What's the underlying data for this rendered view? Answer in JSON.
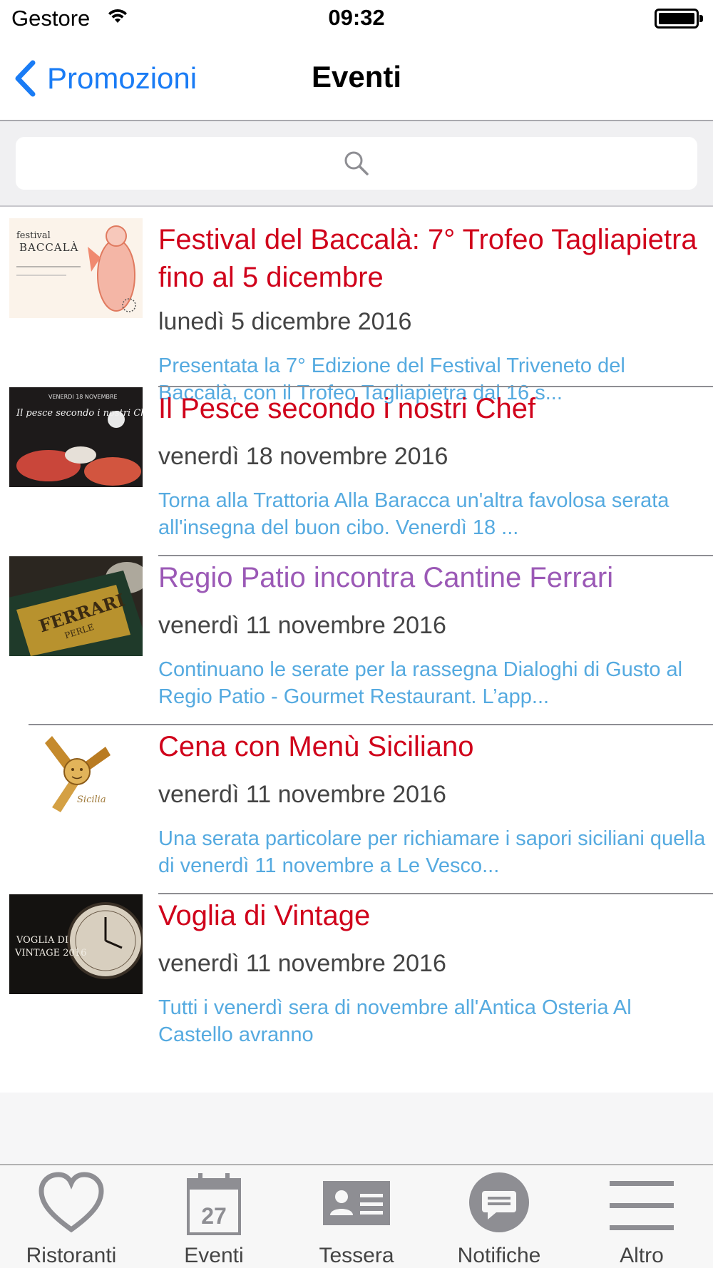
{
  "status_bar": {
    "carrier": "Gestore",
    "time": "09:32"
  },
  "nav": {
    "back_label": "Promozioni",
    "title": "Eventi"
  },
  "search": {
    "placeholder": ""
  },
  "events": [
    {
      "title": "Festival del Baccalà: 7° Trofeo Tagliapietra fino al 5 dicembre",
      "date": "lunedì 5 dicembre 2016",
      "description": "Presentata la 7° Edizione del Festival Triveneto del Baccalà, con il Trofeo Tagliapietra dal 16 s...",
      "thumb_text": {
        "line1": "festival",
        "line2": "BACCALÀ"
      }
    },
    {
      "title": "Il Pesce secondo i nostri Chef",
      "date": "venerdì 18 novembre 2016",
      "description": "Torna alla Trattoria Alla Baracca un'altra favolosa serata all'insegna del buon cibo. Venerdì 18 ...",
      "thumb_text": {
        "line1": "VENERDI 18 NOVEMBRE",
        "line2": "Il pesce secondo i nostri Chef"
      }
    },
    {
      "title": "Regio Patio incontra Cantine Ferrari",
      "date": "venerdì 11 novembre 2016",
      "description": "Continuano le serate per la rassegna Dialoghi di Gusto al Regio Patio - Gourmet Restaurant. L’app...",
      "thumb_text": {
        "line1": "FERRARI",
        "line2": "PERLE"
      }
    },
    {
      "title": "Cena con Menù Siciliano",
      "date": "venerdì 11 novembre 2016",
      "description": "Una serata particolare per richiamare i sapori siciliani quella di venerdì 11 novembre a Le Vesco...",
      "thumb_text": {
        "line1": "Sicilia",
        "line2": ""
      }
    },
    {
      "title": "Voglia di Vintage",
      "date": "venerdì 11 novembre 2016",
      "description": "Tutti i venerdì sera di novembre all'Antica Osteria Al Castello avranno",
      "thumb_text": {
        "line1": "VOGLIA DI",
        "line2": "VINTAGE 2016"
      }
    }
  ],
  "tabs": [
    {
      "label": "Ristoranti",
      "icon": "heart-icon"
    },
    {
      "label": "Eventi",
      "icon": "calendar-icon",
      "badge": "27"
    },
    {
      "label": "Tessera",
      "icon": "card-icon"
    },
    {
      "label": "Notifiche",
      "icon": "message-icon"
    },
    {
      "label": "Altro",
      "icon": "menu-icon"
    }
  ],
  "colors": {
    "accent": "#1a7cf5",
    "title_red": "#d0021b",
    "title_visited": "#9b59b6",
    "description_blue": "#55aae0",
    "date_gray": "#444444"
  }
}
